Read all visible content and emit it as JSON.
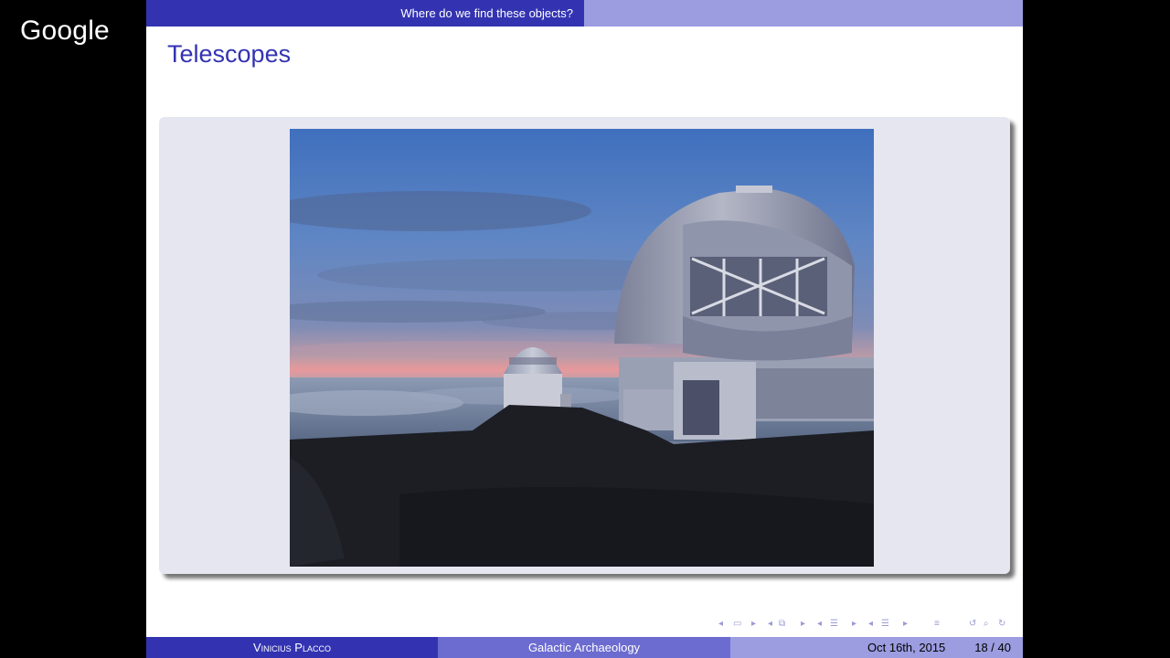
{
  "overlay": {
    "logo_text": "Google"
  },
  "slide": {
    "section_header": "Where do we find these objects?",
    "frame_title": "Telescopes",
    "footer": {
      "author": "Vinicius Placco",
      "talk_title": "Galactic Archaeology",
      "date": "Oct 16th, 2015",
      "page": "18 / 40"
    },
    "nav_icons": [
      "nav-left-arrow-icon",
      "frame-icon",
      "nav-right-arrow-icon",
      "nav-left-arrow-icon",
      "subsection-icon",
      "nav-right-arrow-icon",
      "nav-left-arrow-icon",
      "section-icon",
      "nav-right-arrow-icon",
      "nav-left-arrow-icon",
      "section-icon",
      "nav-right-arrow-icon",
      "toc-icon",
      "back-icon",
      "search-icon",
      "forward-icon"
    ]
  },
  "colors": {
    "beamer_dark": "#3333b2",
    "beamer_mid": "#6b6bd0",
    "beamer_light": "#9c9ce0",
    "figure_box_bg": "#e6e6f0"
  }
}
